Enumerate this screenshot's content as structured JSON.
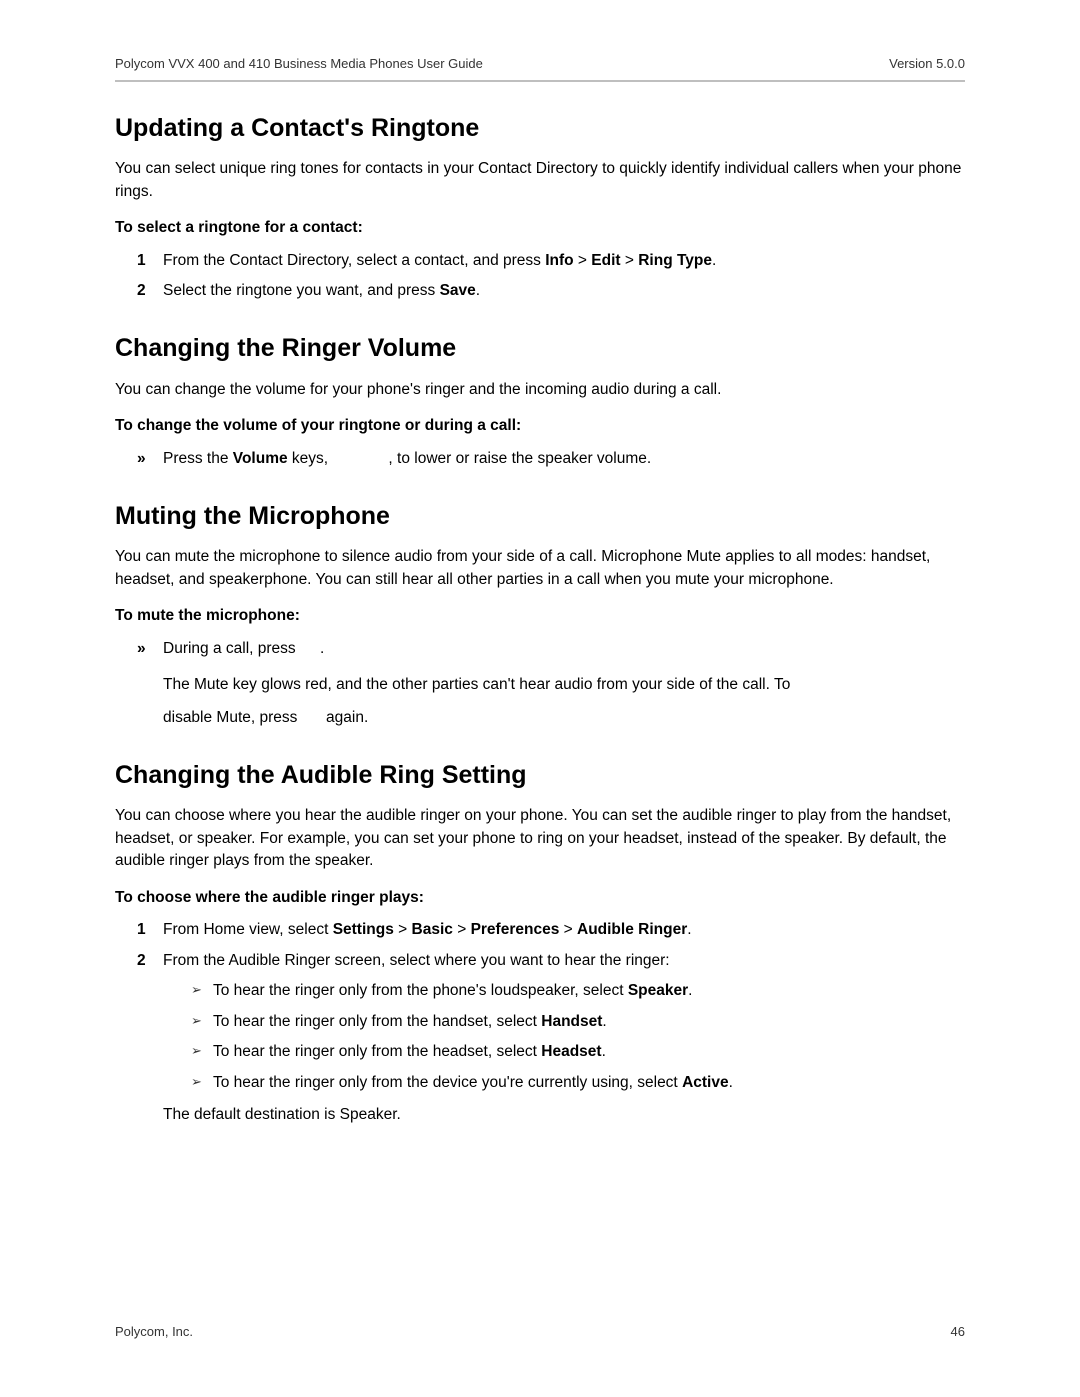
{
  "header": {
    "title": "Polycom VVX 400 and 410 Business Media Phones User Guide",
    "version": "Version 5.0.0"
  },
  "sections": {
    "s1": {
      "title": "Updating a Contact's Ringtone",
      "intro": "You can select unique ring tones for contacts in your Contact Directory to quickly identify individual callers when your phone rings.",
      "lead": "To select a ringtone for a contact:",
      "step1_pre": "From the Contact Directory, select a contact, and press ",
      "step1_b1": "Info",
      "step1_mid1": " > ",
      "step1_b2": "Edit",
      "step1_mid2": " > ",
      "step1_b3": "Ring Type",
      "step1_post": ".",
      "step2_pre": "Select the ringtone you want, and press ",
      "step2_b1": "Save",
      "step2_post": "."
    },
    "s2": {
      "title": "Changing the Ringer Volume",
      "intro": "You can change the volume for your phone's ringer and the incoming audio during a call.",
      "lead": "To change the volume of your ringtone or during a call:",
      "bullet_pre": "Press the ",
      "bullet_b1": "Volume",
      "bullet_mid": " keys, ",
      "bullet_post": ", to lower or raise the speaker volume."
    },
    "s3": {
      "title": "Muting the Microphone",
      "intro": "You can mute the microphone to silence audio from your side of a call. Microphone Mute applies to all modes: handset, headset, and speakerphone. You can still hear all other parties in a call when you mute your microphone.",
      "lead": "To mute the microphone:",
      "bullet1_pre": "During a call, press ",
      "bullet1_post": ".",
      "sub1": "The Mute key glows red, and the other parties can't hear audio from your side of the call. To",
      "sub2_pre": "disable Mute, press ",
      "sub2_post": " again."
    },
    "s4": {
      "title": "Changing the Audible Ring Setting",
      "intro": "You can choose where you hear the audible ringer on your phone. You can set the audible ringer to play from the handset, headset, or speaker. For example, you can set your phone to ring on your headset, instead of the speaker. By default, the audible ringer plays from the speaker.",
      "lead": "To choose where the audible ringer plays:",
      "step1_pre": "From Home view, select ",
      "step1_b1": "Settings",
      "step1_mid1": " > ",
      "step1_b2": "Basic",
      "step1_mid2": " > ",
      "step1_b3": "Preferences",
      "step1_mid3": " > ",
      "step1_b4": "Audible Ringer",
      "step1_post": ".",
      "step2_intro": "From the Audible Ringer screen, select where you want to hear the ringer:",
      "chev1_pre": "To hear the ringer only from the phone's loudspeaker, select ",
      "chev1_b": "Speaker",
      "chev1_post": ".",
      "chev2_pre": "To hear the ringer only from the handset, select ",
      "chev2_b": "Handset",
      "chev2_post": ".",
      "chev3_pre": "To hear the ringer only from the headset, select ",
      "chev3_b": "Headset",
      "chev3_post": ".",
      "chev4_pre": "To hear the ringer only from the device you're currently using, select ",
      "chev4_b": "Active",
      "chev4_post": ".",
      "default_line": "The default destination is Speaker."
    }
  },
  "footer": {
    "company": "Polycom, Inc.",
    "page": "46"
  },
  "markers": {
    "n1": "1",
    "n2": "2"
  }
}
